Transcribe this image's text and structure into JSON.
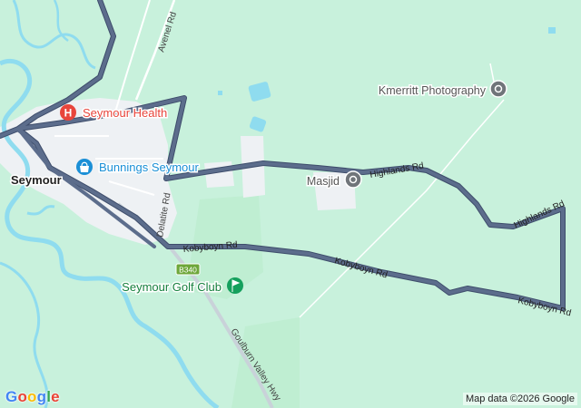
{
  "map": {
    "colors": {
      "land": "#c8f1dc",
      "land_light": "#d8f5e6",
      "urban": "#eef1f4",
      "water": "#8fdcef",
      "route": "#5c6d8c",
      "route_outline": "#3e4d6b",
      "road": "#ffffff",
      "poi_health": "#e8453c",
      "poi_shop": "#1a8fd6",
      "poi_golf": "#15a05d",
      "poi_generic": "#70757a"
    },
    "places": {
      "town": "Seymour"
    },
    "pois": {
      "health": "Seymour Health",
      "bunnings": "Bunnings Seymour",
      "photography": "Kmerritt Photography",
      "masjid": "Masjid",
      "golf": "Seymour Golf Club"
    },
    "roads": {
      "avenel": "Avenel Rd",
      "delatite": "Delatite Rd",
      "kobyboyn_1": "Kobyboyn Rd",
      "kobyboyn_2": "Kobyboyn Rd",
      "kobyboyn_3": "Kobyboyn Rd",
      "highlands_1": "Highlands Rd",
      "highlands_2": "Highlands Rd",
      "goulburn": "Goulburn Valley Hwy",
      "shield": "B340"
    },
    "attribution": "Map data ©2026 Google",
    "logo_letters": [
      "G",
      "o",
      "o",
      "g",
      "l",
      "e"
    ]
  }
}
